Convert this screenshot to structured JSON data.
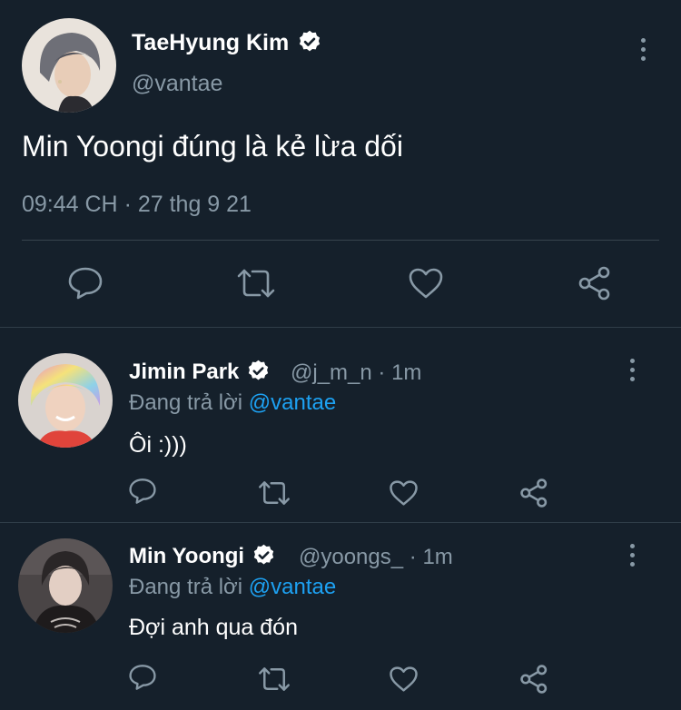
{
  "main_tweet": {
    "author_name": "TaeHyung Kim",
    "author_handle": "@vantae",
    "text": "Min Yoongi đúng là kẻ lừa dối",
    "timestamp": "09:44 CH",
    "date": "27 thg 9 21",
    "separator": " · "
  },
  "replies": [
    {
      "author_name": "Jimin Park",
      "author_handle": "@j_m_n",
      "time": "1m",
      "replying_label": "Đang trả lời",
      "replying_to": "@vantae",
      "text": "Ôi :)))"
    },
    {
      "author_name": "Min Yoongi",
      "author_handle": "@yoongs_",
      "time": "1m",
      "replying_label": "Đang trả lời",
      "replying_to": "@vantae",
      "text": "Đợi anh qua đón"
    }
  ],
  "icons": [
    "verified-icon",
    "more-icon",
    "reply-icon",
    "retweet-icon",
    "like-icon",
    "share-icon"
  ],
  "colors": {
    "background": "#15202b",
    "text": "#ffffff",
    "secondary": "#8899a6",
    "accent": "#1da1f2",
    "divider": "#38444d"
  }
}
